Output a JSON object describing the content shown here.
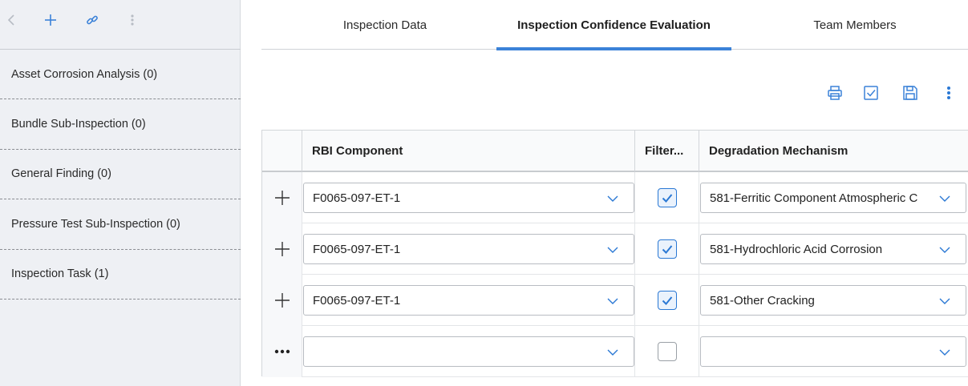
{
  "sidebar": {
    "toolbar": {
      "back_icon": "chevron-left-icon",
      "add_icon": "plus-icon",
      "link_icon": "link-icon",
      "more_icon": "vertical-ellipsis-icon"
    },
    "items": [
      {
        "label": "Asset Corrosion Analysis (0)"
      },
      {
        "label": "Bundle Sub-Inspection (0)"
      },
      {
        "label": "General Finding (0)"
      },
      {
        "label": "Pressure Test Sub-Inspection (0)"
      },
      {
        "label": "Inspection Task (1)"
      }
    ]
  },
  "tabs": [
    {
      "label": "Inspection Data",
      "active": false
    },
    {
      "label": "Inspection Confidence Evaluation",
      "active": true
    },
    {
      "label": "Team Members",
      "active": false
    }
  ],
  "actions": {
    "print_icon": "print-icon",
    "check_icon": "checkbox-icon",
    "save_icon": "save-icon",
    "more_icon": "vertical-ellipsis-icon"
  },
  "grid": {
    "columns": [
      "",
      "RBI Component",
      "Filter...",
      "Degradation Mechanism"
    ],
    "rows": [
      {
        "row_icon": "plus-icon",
        "component": "F0065-097-ET-1",
        "filter": true,
        "mechanism": "581-Ferritic Component Atmospheric C"
      },
      {
        "row_icon": "plus-icon",
        "component": "F0065-097-ET-1",
        "filter": true,
        "mechanism": "581-Hydrochloric Acid Corrosion"
      },
      {
        "row_icon": "plus-icon",
        "component": "F0065-097-ET-1",
        "filter": true,
        "mechanism": "581-Other Cracking"
      },
      {
        "row_icon": "horizontal-ellipsis-icon",
        "component": "",
        "filter": false,
        "mechanism": ""
      }
    ]
  },
  "colors": {
    "accent": "#3b82d8",
    "sidebar_bg": "#eef0f4",
    "icon_blue": "#2a78d4"
  }
}
